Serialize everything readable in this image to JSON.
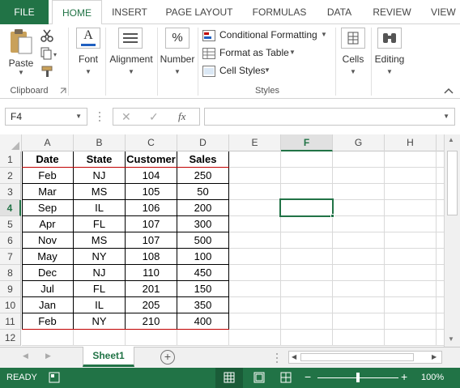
{
  "ribbon_tabs": [
    "FILE",
    "HOME",
    "INSERT",
    "PAGE LAYOUT",
    "FORMULAS",
    "DATA",
    "REVIEW",
    "VIEW"
  ],
  "clipboard": {
    "paste_label": "Paste",
    "group_label": "Clipboard"
  },
  "font": {
    "label": "Font"
  },
  "alignment": {
    "label": "Alignment"
  },
  "number": {
    "label": "Number"
  },
  "styles": {
    "conditional": "Conditional Formatting",
    "format_table": "Format as Table",
    "cell_styles": "Cell Styles",
    "group_label": "Styles"
  },
  "cells": {
    "label": "Cells"
  },
  "editing": {
    "label": "Editing"
  },
  "formula_bar": {
    "name_box": "F4",
    "fx": "fx",
    "value": ""
  },
  "columns": [
    "A",
    "B",
    "C",
    "D",
    "E",
    "F",
    "G",
    "H"
  ],
  "rows": [
    "1",
    "2",
    "3",
    "4",
    "5",
    "6",
    "7",
    "8",
    "9",
    "10",
    "11",
    "12"
  ],
  "table": {
    "headers": [
      "Date",
      "State",
      "Customer",
      "Sales"
    ],
    "rows": [
      [
        "Feb",
        "NJ",
        "104",
        "250"
      ],
      [
        "Mar",
        "MS",
        "105",
        "50"
      ],
      [
        "Sep",
        "IL",
        "106",
        "200"
      ],
      [
        "Apr",
        "FL",
        "107",
        "300"
      ],
      [
        "Nov",
        "MS",
        "107",
        "500"
      ],
      [
        "May",
        "NY",
        "108",
        "100"
      ],
      [
        "Dec",
        "NJ",
        "110",
        "450"
      ],
      [
        "Jul",
        "FL",
        "201",
        "150"
      ],
      [
        "Jan",
        "IL",
        "205",
        "350"
      ],
      [
        "Feb",
        "NY",
        "210",
        "400"
      ]
    ]
  },
  "sheet_tab": "Sheet1",
  "status": {
    "ready": "READY",
    "zoom": "100%"
  },
  "colors": {
    "accent": "#217346",
    "table_rule": "#c00000"
  }
}
